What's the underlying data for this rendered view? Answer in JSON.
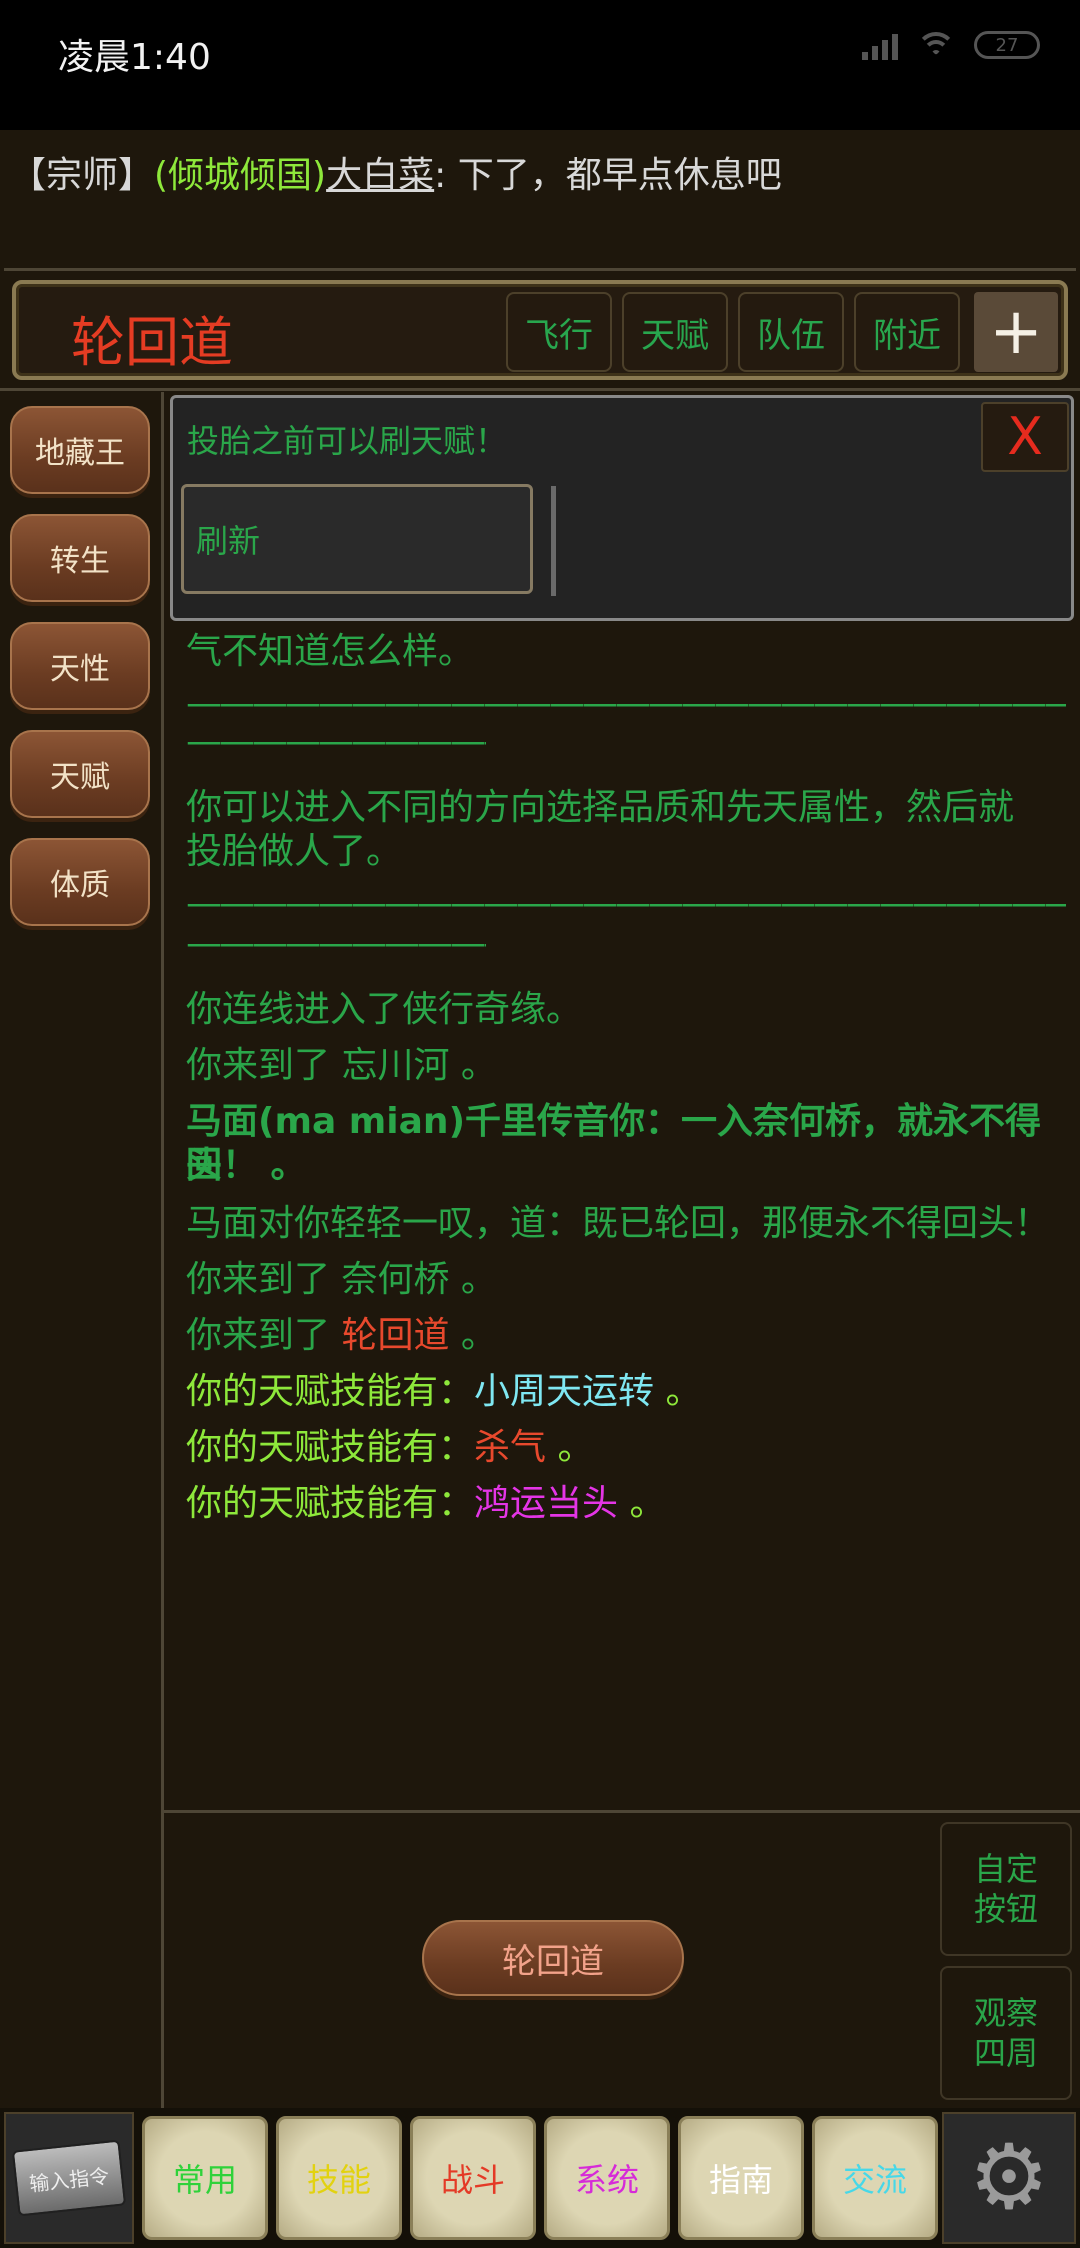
{
  "status_bar": {
    "time": "凌晨1:40",
    "battery": "27"
  },
  "chat": {
    "rank": "【宗师】",
    "guild": "(倾城倾国)",
    "user": "大白菜",
    "message": ": 下了，都早点休息吧"
  },
  "header": {
    "title": "轮回道",
    "buttons": [
      "飞行",
      "天赋",
      "队伍",
      "附近"
    ],
    "plus": "+"
  },
  "sidebar": {
    "items": [
      "地藏王",
      "转生",
      "天性",
      "天赋",
      "体质"
    ]
  },
  "popup": {
    "text": "投胎之前可以刷天赋！",
    "close": "X",
    "refresh": "刷新"
  },
  "log": {
    "line0": "气不知道怎么样。",
    "dash": "——————————————————————————————————",
    "line1a": "你可以进入不同的方向选择品质和先天属性，然后就",
    "line1b": "投胎做人了。",
    "line2": "你连线进入了侠行奇缘。",
    "line3_prefix": "你来到了 ",
    "line3_place": "忘川河",
    "line3_suffix": " 。",
    "line4a": "马面(ma mian)千里传音你：一入奈何桥，就永不得回",
    "line4b": "头！ 。",
    "line5": "马面对你轻轻一叹，道：既已轮回，那便永不得回头！",
    "line6_prefix": "你来到了 ",
    "line6_place": "奈何桥",
    "line6_suffix": " 。",
    "line7_prefix": "你来到了 ",
    "line7_place": "轮回道",
    "line7_suffix": " 。",
    "talent_prefix": "你的天赋技能有：",
    "talent1": "小周天运转",
    "talent2": "杀气",
    "talent3": "鸿运当头",
    "period": " 。"
  },
  "bottom": {
    "location_pill": "轮回道",
    "custom_button": [
      "自定",
      "按钮"
    ],
    "observe_button": [
      "观察",
      "四周"
    ]
  },
  "tabbar": {
    "command": "输入指令",
    "tabs": [
      {
        "label": "常用",
        "color": "#2fd23a"
      },
      {
        "label": "技能",
        "color": "#e2d210"
      },
      {
        "label": "战斗",
        "color": "#e43a26"
      },
      {
        "label": "系统",
        "color": "#d62ad8"
      },
      {
        "label": "指南",
        "color": "#ffffff"
      },
      {
        "label": "交流",
        "color": "#47d8e8"
      }
    ],
    "gear_label": "系统"
  }
}
